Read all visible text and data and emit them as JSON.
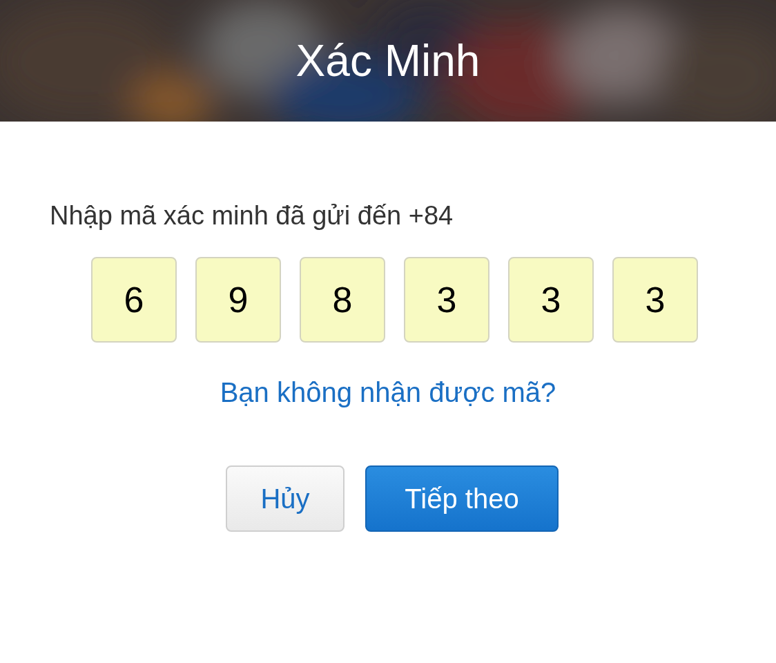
{
  "header": {
    "title": "Xác Minh",
    "kind": "picture"
  },
  "prompt": "Nhập mã xác minh đã gửi đến +84",
  "code_digits": [
    {
      "value": "6"
    },
    {
      "value": "9"
    },
    {
      "value": "8"
    },
    {
      "value": "3"
    },
    {
      "value": "3"
    },
    {
      "value": "3"
    }
  ],
  "resend_link": "Bạn không nhận được mã?",
  "buttons": [
    {
      "label": "Hủy",
      "kind": "secondary"
    },
    {
      "label": "Tiếp theo",
      "kind": "primary"
    }
  ]
}
